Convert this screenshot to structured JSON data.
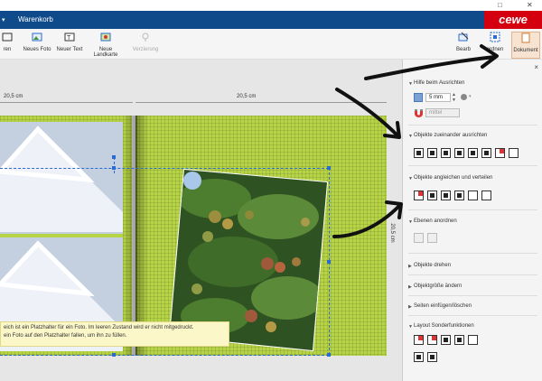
{
  "window": {
    "maximize_glyph": "□",
    "close_glyph": "✕"
  },
  "header": {
    "menu_caret": "▾",
    "title": "Warenkorb",
    "logo": "cewe"
  },
  "toolbar": {
    "items": [
      {
        "label": "ren",
        "icon": "image-edit-icon"
      },
      {
        "label": "Neues Foto",
        "icon": "photo-icon"
      },
      {
        "label": "Neuer Text",
        "icon": "text-icon"
      },
      {
        "label": "Neue Landkarte",
        "icon": "map-icon"
      },
      {
        "label": "Verzierung",
        "icon": "decoration-icon"
      },
      {
        "label": "Bearb",
        "icon": "edit-icon"
      },
      {
        "label": "ordnen",
        "icon": "arrange-icon"
      },
      {
        "label": "Dokument",
        "icon": "document-icon"
      }
    ]
  },
  "canvas": {
    "ruler_left": "20,5 cm",
    "ruler_right": "20,5 cm",
    "height_label": "20,5 cm",
    "tooltip_line1": "eich ist ein Platzhalter für ein Foto. Im leeren Zustand wird er nicht mitgedruckt.",
    "tooltip_line2": "ein Foto auf den Platzhalter fallen, um ihn zu füllen."
  },
  "panel": {
    "close_glyph": "×",
    "hilfe": {
      "title": "Hilfe beim Ausrichten",
      "value": "5 mm",
      "strength": "mittel"
    },
    "sections": [
      "Objekte zueinander ausrichten",
      "Objekte angleichen und verteilen",
      "Ebenen anordnen",
      "Objekte drehen",
      "Objektgröße ändern",
      "Seiten einfügen/löschen",
      "Layout Sonderfunktionen"
    ]
  },
  "colors": {
    "header_blue": "#0f4a8a",
    "logo_red": "#d4000f",
    "page_green": "#b7d446",
    "frame_blue": "#2a6ad1"
  }
}
